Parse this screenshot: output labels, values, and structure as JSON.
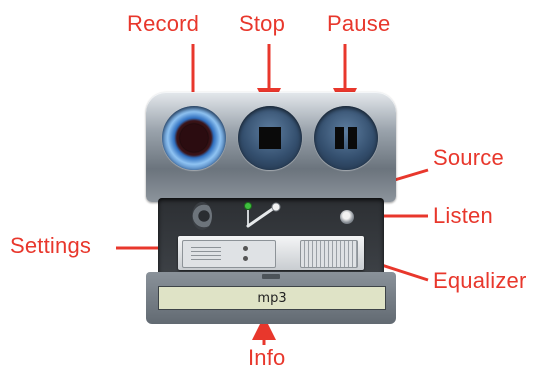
{
  "callouts": {
    "record": "Record",
    "stop": "Stop",
    "pause": "Pause",
    "source": "Source",
    "listen": "Listen",
    "settings": "Settings",
    "equalizer": "Equalizer",
    "info": "Info"
  },
  "recorder": {
    "info_text": "mp3",
    "icons": {
      "record": "record-dot-icon",
      "stop": "stop-square-icon",
      "pause": "pause-bars-icon",
      "source": "microphone-icon",
      "listen": "speaker-knob-icon",
      "settings": "settings-rack-icon",
      "equalizer": "equalizer-rack-icon"
    }
  },
  "colors": {
    "callout": "#e8372c",
    "info_bar_bg": "#dfe3c6"
  }
}
